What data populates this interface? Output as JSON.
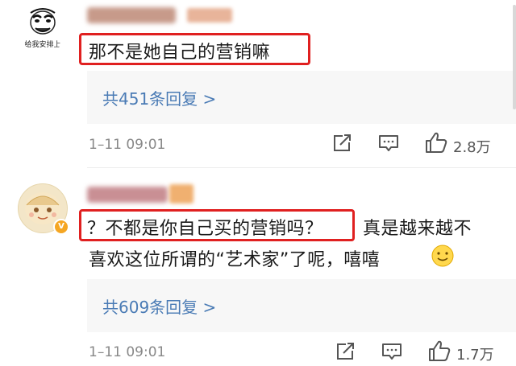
{
  "comments": [
    {
      "avatar_caption": "给我安排上",
      "text": "那不是她自己的营销嘛",
      "replies_link": "共451条回复 >",
      "time": "1–11 09:01",
      "like_count": "2.8万"
    },
    {
      "badge": "V",
      "text_highlight": "？不都是你自己买的营销吗？",
      "text_rest_line1": "真是越来越不",
      "text_line2": "喜欢这位所谓的“艺术家”了呢，嘻嘻",
      "replies_link": "共609条回复 >",
      "time": "1–11 09:01",
      "like_count": "1.7万"
    }
  ]
}
